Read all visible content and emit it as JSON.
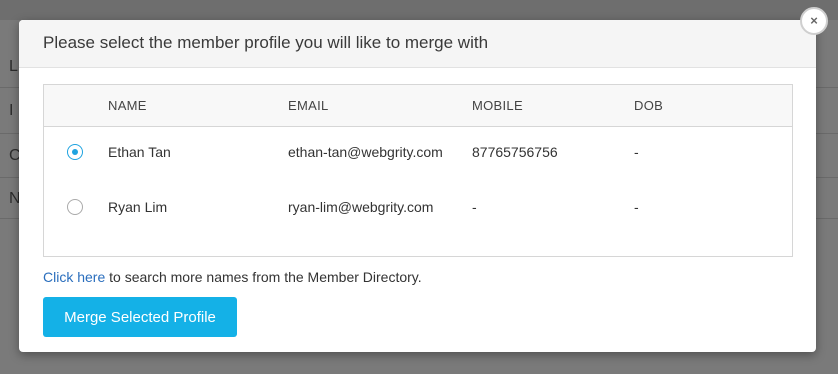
{
  "background": {
    "letters": [
      "L",
      "I",
      "C",
      "N"
    ]
  },
  "modal": {
    "title": "Please select the member profile you will like to merge with",
    "close_label": "×"
  },
  "table": {
    "headers": {
      "name": "NAME",
      "email": "EMAIL",
      "mobile": "MOBILE",
      "dob": "DOB"
    },
    "rows": [
      {
        "selected": true,
        "name": "Ethan Tan",
        "email": "ethan-tan@webgrity.com",
        "mobile": "87765756756",
        "dob": "-"
      },
      {
        "selected": false,
        "name": "Ryan Lim",
        "email": "ryan-lim@webgrity.com",
        "mobile": "-",
        "dob": "-"
      }
    ]
  },
  "footer": {
    "link_text": "Click here",
    "link_suffix": " to search more names from the Member Directory.",
    "merge_button": "Merge Selected Profile"
  },
  "colors": {
    "accent": "#14b1e7",
    "link": "#2a6ebd",
    "overlay": "#7a7a7a"
  }
}
